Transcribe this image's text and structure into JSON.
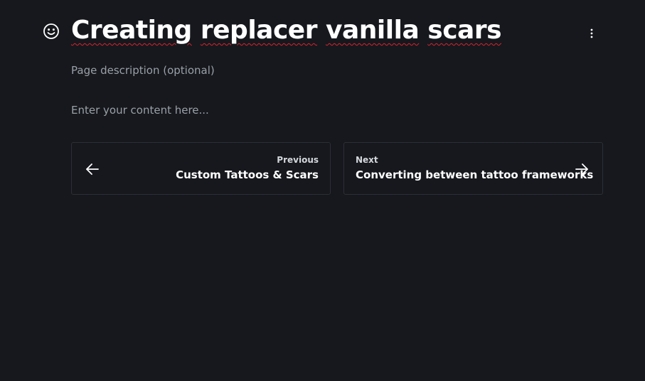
{
  "page": {
    "title_parts": [
      "Creating",
      " ",
      "replacer",
      " ",
      "vanilla",
      " ",
      "scars"
    ],
    "description_placeholder": "Page description (optional)",
    "content_placeholder": "Enter your content here..."
  },
  "icons": {
    "emoji": "smiley-face-icon",
    "menu": "vertical-ellipsis-icon",
    "previous": "arrow-left-icon",
    "next": "arrow-right-icon"
  },
  "navigation": {
    "previous": {
      "label": "Previous",
      "title": "Custom Tattoos & Scars"
    },
    "next": {
      "label": "Next",
      "title": "Converting between tattoo frameworks"
    }
  },
  "colors": {
    "background": "#16181d",
    "card_border": "#2c2f36",
    "muted_text": "#9aa0a8",
    "spellcheck_underline": "#d9232e"
  }
}
